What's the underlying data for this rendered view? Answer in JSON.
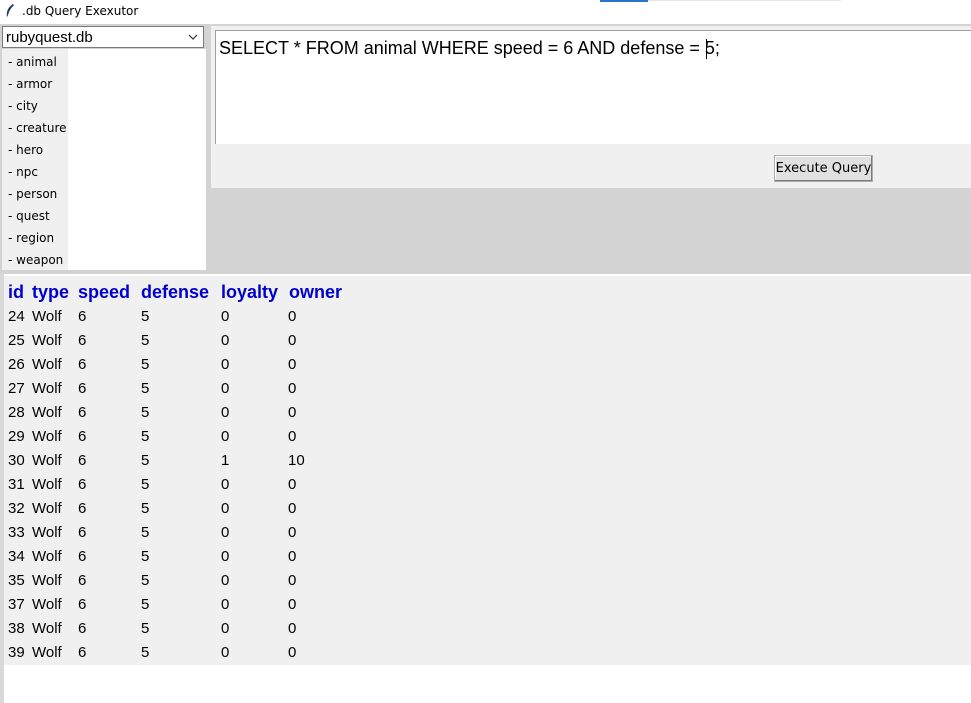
{
  "window": {
    "title": ".db Query Exexutor",
    "icon": "feather-icon"
  },
  "database": {
    "selected": "rubyquest.db"
  },
  "tables": [
    "- animal",
    "- armor",
    "- city",
    "- creature",
    "- hero",
    "- npc",
    "- person",
    "- quest",
    "- region",
    "- weapon"
  ],
  "query": {
    "text": "SELECT * FROM animal WHERE speed = 6 AND defense = 5;"
  },
  "execute_button": {
    "label": "Execute Query"
  },
  "results": {
    "columns": [
      "id",
      "type",
      "speed",
      "defense",
      "loyalty",
      "owner"
    ],
    "rows": [
      [
        "24",
        "Wolf",
        "6",
        "5",
        "0",
        "0"
      ],
      [
        "25",
        "Wolf",
        "6",
        "5",
        "0",
        "0"
      ],
      [
        "26",
        "Wolf",
        "6",
        "5",
        "0",
        "0"
      ],
      [
        "27",
        "Wolf",
        "6",
        "5",
        "0",
        "0"
      ],
      [
        "28",
        "Wolf",
        "6",
        "5",
        "0",
        "0"
      ],
      [
        "29",
        "Wolf",
        "6",
        "5",
        "0",
        "0"
      ],
      [
        "30",
        "Wolf",
        "6",
        "5",
        "1",
        "10"
      ],
      [
        "31",
        "Wolf",
        "6",
        "5",
        "0",
        "0"
      ],
      [
        "32",
        "Wolf",
        "6",
        "5",
        "0",
        "0"
      ],
      [
        "33",
        "Wolf",
        "6",
        "5",
        "0",
        "0"
      ],
      [
        "34",
        "Wolf",
        "6",
        "5",
        "0",
        "0"
      ],
      [
        "35",
        "Wolf",
        "6",
        "5",
        "0",
        "0"
      ],
      [
        "37",
        "Wolf",
        "6",
        "5",
        "0",
        "0"
      ],
      [
        "38",
        "Wolf",
        "6",
        "5",
        "0",
        "0"
      ],
      [
        "39",
        "Wolf",
        "6",
        "5",
        "0",
        "0"
      ]
    ]
  },
  "colors": {
    "header_text": "#0000cc",
    "frame_bg": "#d3d3d3",
    "panel_bg": "#f0f0f0"
  }
}
